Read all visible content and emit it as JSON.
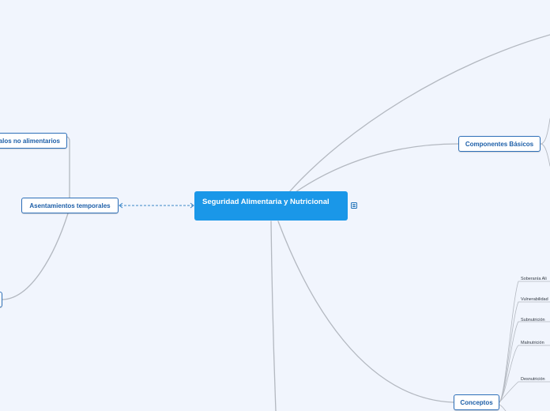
{
  "central": {
    "title": "Seguridad Alimentaria y Nutricional"
  },
  "branches": {
    "componentes": "Componentes Básicos",
    "conceptos": "Conceptos",
    "asentamientos": "Asentamientos temporales",
    "articulos": "alos no alimentarios"
  },
  "concept_items": [
    "Soberanía Ali",
    "Vulnerabilidad",
    "Subnutrición",
    "Malnutrición",
    "Desnutrición"
  ],
  "icons": {
    "notes": "notes-icon"
  },
  "colors": {
    "background": "#f1f5fd",
    "central_fill": "#1a97e8",
    "node_border": "#2d6fb8",
    "node_text": "#1d5fa8",
    "connector": "#b0b6bf"
  }
}
